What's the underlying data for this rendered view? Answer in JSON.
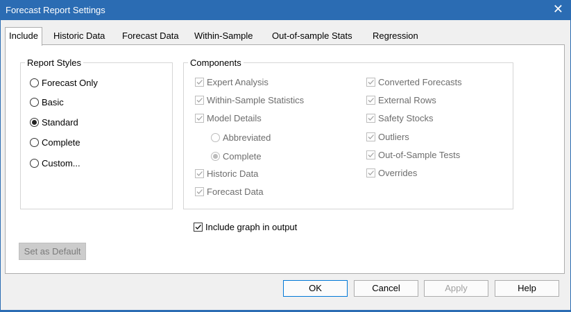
{
  "window": {
    "title": "Forecast Report Settings",
    "close_glyph": "✕"
  },
  "tabs": [
    {
      "label": "Include",
      "active": true
    },
    {
      "label": "Historic Data"
    },
    {
      "label": "Forecast Data"
    },
    {
      "label": "Within-Sample"
    },
    {
      "label": "Out-of-sample Stats"
    },
    {
      "label": "Regression"
    }
  ],
  "report_styles": {
    "legend": "Report Styles",
    "options": [
      {
        "label": "Forecast Only",
        "selected": false
      },
      {
        "label": "Basic",
        "selected": false
      },
      {
        "label": "Standard",
        "selected": true
      },
      {
        "label": "Complete",
        "selected": false
      },
      {
        "label": "Custom...",
        "selected": false
      }
    ]
  },
  "components": {
    "legend": "Components",
    "left": [
      {
        "label": "Expert Analysis",
        "checked": true
      },
      {
        "label": "Within-Sample Statistics",
        "checked": true
      },
      {
        "label": "Model Details",
        "checked": true
      }
    ],
    "model_detail_options": [
      {
        "label": "Abbreviated",
        "selected": false
      },
      {
        "label": "Complete",
        "selected": true
      }
    ],
    "left_bottom": [
      {
        "label": "Historic Data",
        "checked": true
      },
      {
        "label": "Forecast Data",
        "checked": true
      }
    ],
    "right": [
      {
        "label": "Converted Forecasts",
        "checked": true
      },
      {
        "label": "External Rows",
        "checked": true
      },
      {
        "label": "Safety Stocks",
        "checked": true
      },
      {
        "label": "Outliers",
        "checked": true
      },
      {
        "label": "Out-of-Sample Tests",
        "checked": true
      },
      {
        "label": "Overrides",
        "checked": true
      }
    ]
  },
  "include_graph": {
    "label": "Include graph in output",
    "checked": true
  },
  "buttons": {
    "set_default": "Set as Default",
    "ok": "OK",
    "cancel": "Cancel",
    "apply": "Apply",
    "help": "Help"
  }
}
